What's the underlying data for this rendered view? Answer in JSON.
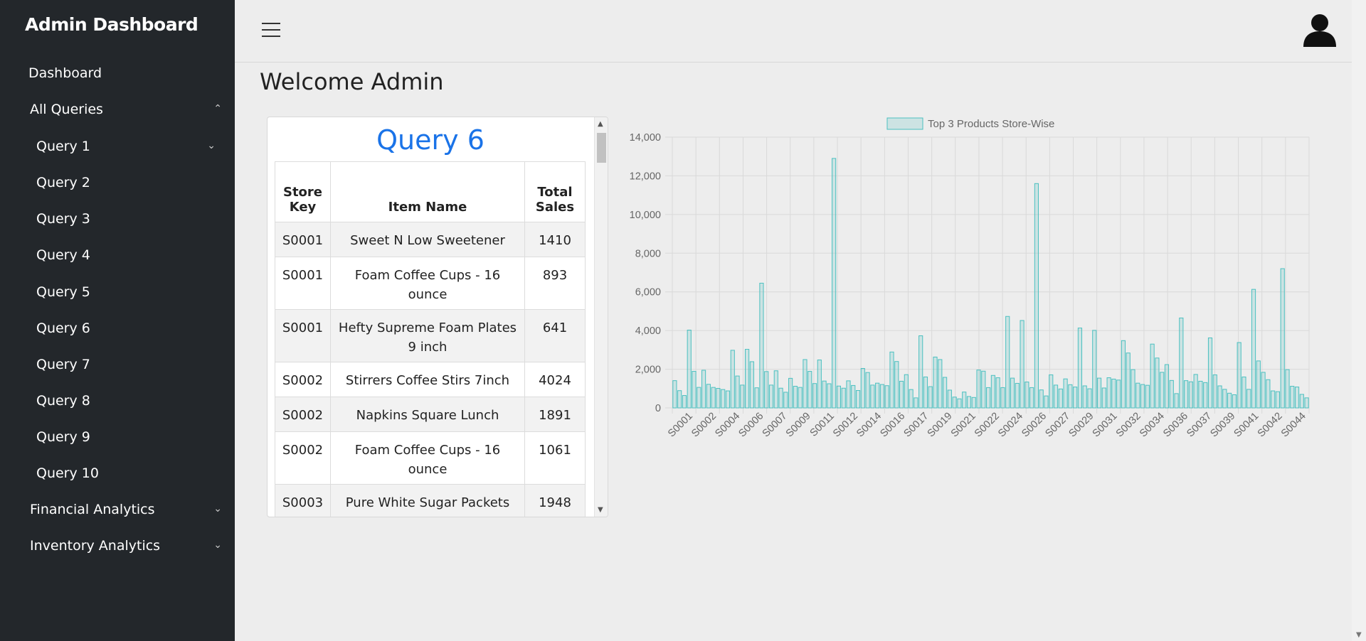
{
  "sidebar": {
    "brand": "Admin Dashboard",
    "dashboard": "Dashboard",
    "all_queries": "All Queries",
    "queries": [
      "Query 1",
      "Query 2",
      "Query 3",
      "Query 4",
      "Query 5",
      "Query 6",
      "Query 7",
      "Query 8",
      "Query 9",
      "Query 10"
    ],
    "financial": "Financial Analytics",
    "inventory": "Inventory Analytics"
  },
  "header": {
    "welcome": "Welcome Admin"
  },
  "query": {
    "title": "Query 6",
    "columns": [
      "Store Key",
      "Item Name",
      "Total Sales"
    ],
    "rows": [
      [
        "S0001",
        "Sweet N Low Sweetener",
        "1410"
      ],
      [
        "S0001",
        "Foam Coffee Cups - 16 ounce",
        "893"
      ],
      [
        "S0001",
        "Hefty Supreme Foam Plates 9 inch",
        "641"
      ],
      [
        "S0002",
        "Stirrers Coffee Stirs 7inch",
        "4024"
      ],
      [
        "S0002",
        "Napkins Square Lunch",
        "1891"
      ],
      [
        "S0002",
        "Foam Coffee Cups - 16 ounce",
        "1061"
      ],
      [
        "S0003",
        "Pure White Sugar Packets",
        "1948"
      ]
    ]
  },
  "chart_data": {
    "type": "bar",
    "legend": "Top 3 Products Store-Wise",
    "legend_position": "top",
    "grid": true,
    "ylim": [
      0,
      14000
    ],
    "yticks": [
      0,
      2000,
      4000,
      6000,
      8000,
      10000,
      12000,
      14000
    ],
    "ytick_labels": [
      "0",
      "2,000",
      "4,000",
      "6,000",
      "8,000",
      "10,000",
      "12,000",
      "14,000"
    ],
    "xtick_labels": [
      "S0001",
      "S0002",
      "S0004",
      "S0006",
      "S0007",
      "S0009",
      "S0011",
      "S0012",
      "S0014",
      "S0016",
      "S0017",
      "S0019",
      "S0021",
      "S0022",
      "S0024",
      "S0026",
      "S0027",
      "S0029",
      "S0031",
      "S0032",
      "S0034",
      "S0036",
      "S0037",
      "S0039",
      "S0041",
      "S0042",
      "S0044"
    ],
    "values": [
      1410,
      893,
      641,
      4024,
      1891,
      1061,
      1948,
      1220,
      1060,
      1010,
      950,
      880,
      2980,
      1650,
      1180,
      3030,
      2390,
      1040,
      6450,
      1880,
      1180,
      1920,
      1020,
      810,
      1530,
      1120,
      1060,
      2500,
      1890,
      1260,
      2480,
      1390,
      1250,
      12900,
      1130,
      1020,
      1400,
      1160,
      900,
      2040,
      1830,
      1180,
      1280,
      1210,
      1150,
      2890,
      2400,
      1380,
      1720,
      950,
      520,
      3730,
      1600,
      1100,
      2630,
      2500,
      1580,
      920,
      560,
      470,
      820,
      590,
      540,
      1960,
      1900,
      1050,
      1680,
      1560,
      1050,
      4730,
      1540,
      1270,
      4520,
      1340,
      1050,
      11600,
      930,
      620,
      1710,
      1180,
      980,
      1500,
      1200,
      1080,
      4130,
      1140,
      990,
      4010,
      1540,
      1030,
      1560,
      1490,
      1440,
      3480,
      2840,
      1980,
      1280,
      1210,
      1170,
      3300,
      2580,
      1840,
      2240,
      1420,
      740,
      4650,
      1410,
      1350,
      1730,
      1380,
      1310,
      3620,
      1710,
      1140,
      960,
      760,
      680,
      3380,
      1600,
      960,
      6130,
      2430,
      1840,
      1460,
      880,
      840,
      7200,
      1980,
      1120,
      1080,
      700,
      520
    ]
  },
  "colors": {
    "sidebar_bg": "#23272b",
    "accent": "#1a73e8",
    "bar_fill": "rgba(75,192,192,0.2)",
    "bar_border": "#4bc0c0"
  }
}
